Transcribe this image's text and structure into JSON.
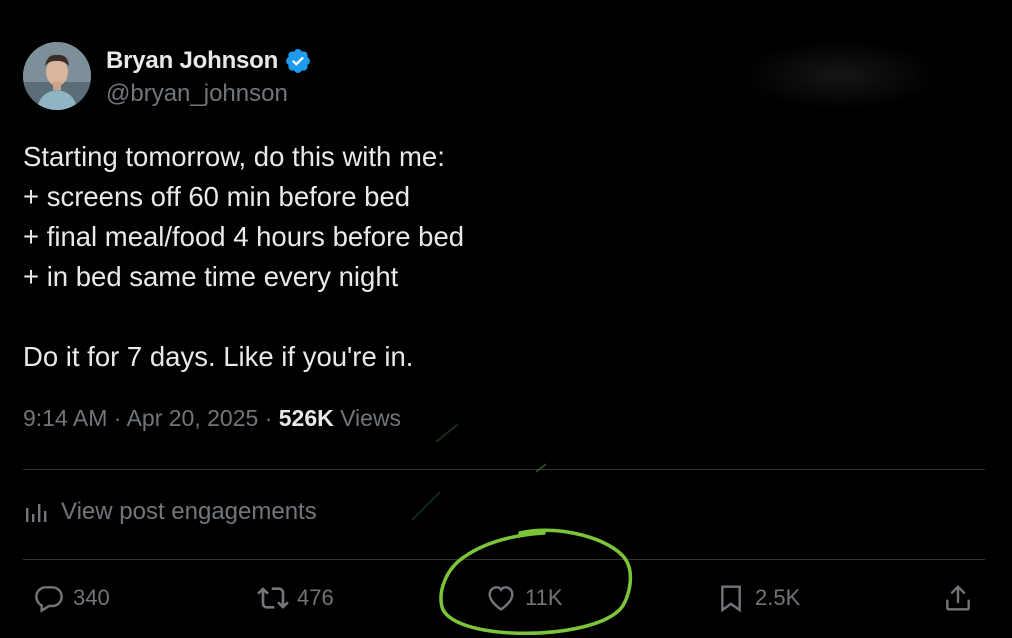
{
  "author": {
    "display_name": "Bryan Johnson",
    "handle": "@bryan_johnson",
    "verified": true,
    "avatar_icon": "profile-photo"
  },
  "post": {
    "lines": [
      "Starting tomorrow, do this with me:",
      "+ screens off 60 min before bed",
      "+ final meal/food 4 hours before bed",
      "+ in bed same time every night",
      "",
      "Do it for 7 days. Like if you're in."
    ],
    "time": "9:14 AM",
    "separator": "·",
    "date": "Apr 20, 2025",
    "views_count": "526K",
    "views_label": "Views"
  },
  "engagements_link": {
    "label": "View post engagements",
    "icon": "bar-chart-icon"
  },
  "actions": {
    "reply": {
      "count": "340",
      "icon": "reply-icon"
    },
    "repost": {
      "count": "476",
      "icon": "repost-icon"
    },
    "like": {
      "count": "11K",
      "icon": "heart-icon"
    },
    "bookmark": {
      "count": "2.5K",
      "icon": "bookmark-icon"
    },
    "share": {
      "icon": "share-icon"
    }
  },
  "colors": {
    "background": "#000000",
    "text_primary": "#e7e9ea",
    "text_secondary": "#71767b",
    "divider": "#2f3336",
    "verified_badge": "#1d9bf0",
    "annotation_circle": "#7cc43a"
  }
}
